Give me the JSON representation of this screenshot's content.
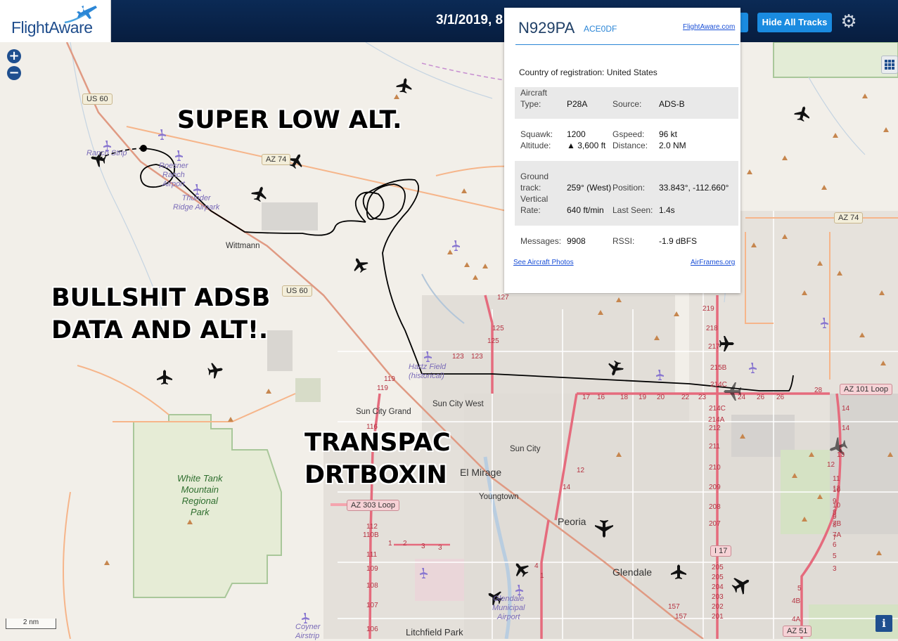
{
  "header": {
    "brand": "FlightAware",
    "date_text": "3/1/2019, 8",
    "hide_tracks_label": "Hide All Tracks",
    "brand_color": "#1f4d8c",
    "button_color": "#1a8be0"
  },
  "map": {
    "zoom_in": "+",
    "zoom_out": "−",
    "scale_label": "2 nm",
    "info_label": "i",
    "track_color": "#000000",
    "places": {
      "wittmann": "Wittmann",
      "sun_city_grand": "Sun City Grand",
      "sun_city_west": "Sun City West",
      "sun_city": "Sun City",
      "el_mirage": "El Mirage",
      "youngtown": "Youngtown",
      "peoria": "Peoria",
      "glendale": "Glendale",
      "litchfield_park": "Litchfield Park"
    },
    "airports": {
      "ranch_strip": "Ranch Strip",
      "roesner": "Roesner\nRanch\nAirport",
      "thunder_ridge": "Thunder\nRidge Airpark",
      "hartz_field": "Hartz Field\n(historical)",
      "glendale_muni": "Glendale\nMunicipal\nAirport",
      "coyner": "Coyner\nAirstrip"
    },
    "park": "White Tank\nMountain\nRegional\nPark",
    "shields": {
      "us60_a": "US 60",
      "us60_b": "US 60",
      "az74_a": "AZ 74",
      "az74_b": "AZ 74",
      "az303": "AZ 303 Loop",
      "az101": "AZ 101 Loop",
      "i17": "I 17",
      "az51": "AZ 51"
    },
    "exits": [
      "127",
      "125",
      "125",
      "123",
      "123",
      "119",
      "119",
      "116",
      "112",
      "110B",
      "111",
      "109",
      "108",
      "107",
      "106",
      "1",
      "2",
      "3",
      "3",
      "17",
      "16",
      "18",
      "19",
      "20",
      "22",
      "23",
      "24",
      "26",
      "26",
      "28",
      "219",
      "218",
      "217",
      "215B",
      "214C",
      "214C",
      "214A",
      "212",
      "211",
      "210",
      "209",
      "208",
      "207",
      "205",
      "205",
      "204",
      "203",
      "202",
      "201",
      "157",
      "157",
      "14",
      "14",
      "13",
      "12",
      "10",
      "9",
      "8",
      "7",
      "5",
      "4B",
      "4A",
      "12",
      "11",
      "10",
      "9",
      "8",
      "7B",
      "7A",
      "6",
      "5",
      "3",
      "4",
      "1",
      "14",
      "12"
    ],
    "annotations": {
      "low_alt": "SUPER LOW ALT.",
      "adsb_line1": "BULLSHIT ADSB",
      "adsb_line2": "DATA AND ALT!.",
      "transpac_line1": "TRANSPAC",
      "transpac_line2": "DRTBOXIN"
    }
  },
  "popup": {
    "registration": "N929PA",
    "hex": "ACE0DF",
    "fa_link": "FlightAware.com",
    "country_label": "Country of registration:",
    "country_value": "United States",
    "type_label": "Aircraft\nType:",
    "type_value": "P28A",
    "source_label": "Source:",
    "source_value": "ADS-B",
    "squawk_label": "Squawk:",
    "squawk_value": "1200",
    "altitude_label": "Altitude:",
    "altitude_value": "▲ 3,600 ft",
    "gspeed_label": "Gspeed:",
    "gspeed_value": "96 kt",
    "distance_label": "Distance:",
    "distance_value": "2.0 NM",
    "track_label": "Ground\ntrack:",
    "track_value": "259° (West)",
    "position_label": "Position:",
    "position_value": "33.843°, -112.660°",
    "vrate_label": "Vertical\nRate:",
    "vrate_value": "640 ft/min",
    "lastseen_label": "Last Seen:",
    "lastseen_value": "1.4s",
    "messages_label": "Messages:",
    "messages_value": "9908",
    "rssi_label": "RSSI:",
    "rssi_value": "-1.9 dBFS",
    "photos_link": "See Aircraft Photos",
    "airframes_link": "AirFrames.org"
  }
}
